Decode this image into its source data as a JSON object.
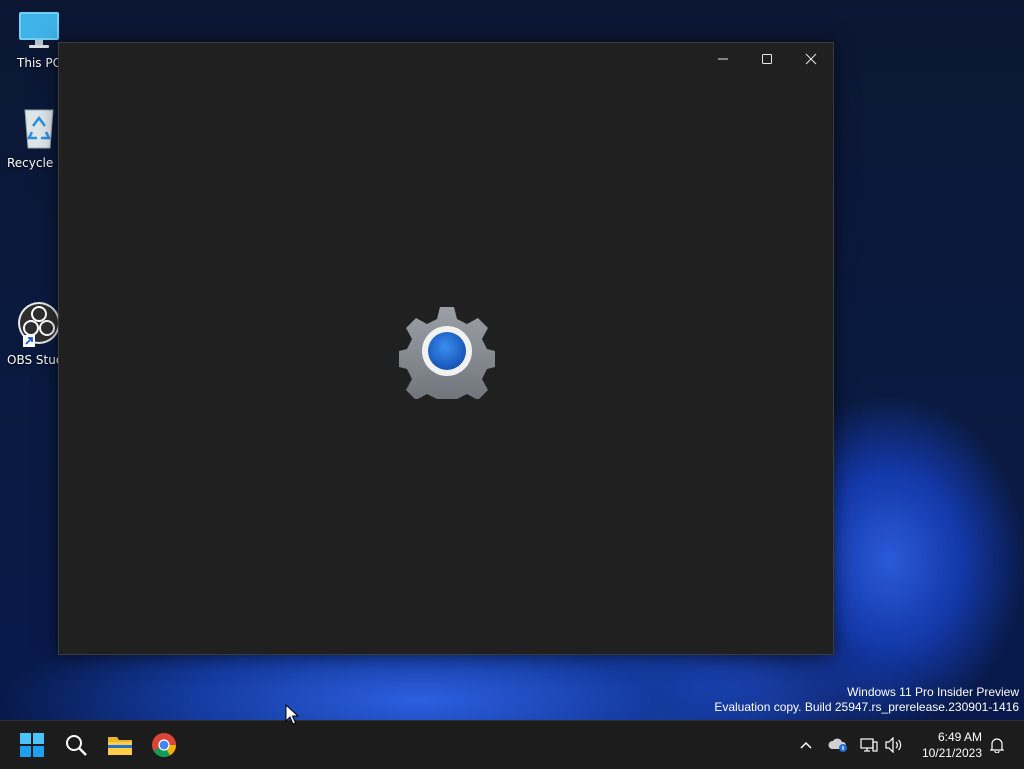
{
  "desktop": {
    "icons": [
      {
        "label": "This PC",
        "icon": "this-pc-icon"
      },
      {
        "label": "Recycle Bin",
        "icon": "recycle-bin-icon"
      },
      {
        "label": "OBS Studio",
        "icon": "obs-studio-icon"
      }
    ],
    "watermark": {
      "line1": "Windows 11 Pro Insider Preview",
      "line2": "Evaluation copy. Build 25947.rs_prerelease.230901-1416"
    }
  },
  "window": {
    "controls": [
      "minimize-icon",
      "maximize-icon",
      "close-icon"
    ],
    "splash_icon": "settings-gear-icon",
    "accent": "#1f6fd1"
  },
  "taskbar": {
    "apps": [
      "start-icon",
      "search-icon",
      "file-explorer-icon",
      "chrome-icon"
    ],
    "tray": [
      "chevron-up-icon",
      "onedrive-icon",
      "network-icon",
      "volume-icon"
    ],
    "clock": {
      "time": "6:49 AM",
      "date": "10/21/2023"
    },
    "notification_icon": "bell-icon"
  }
}
